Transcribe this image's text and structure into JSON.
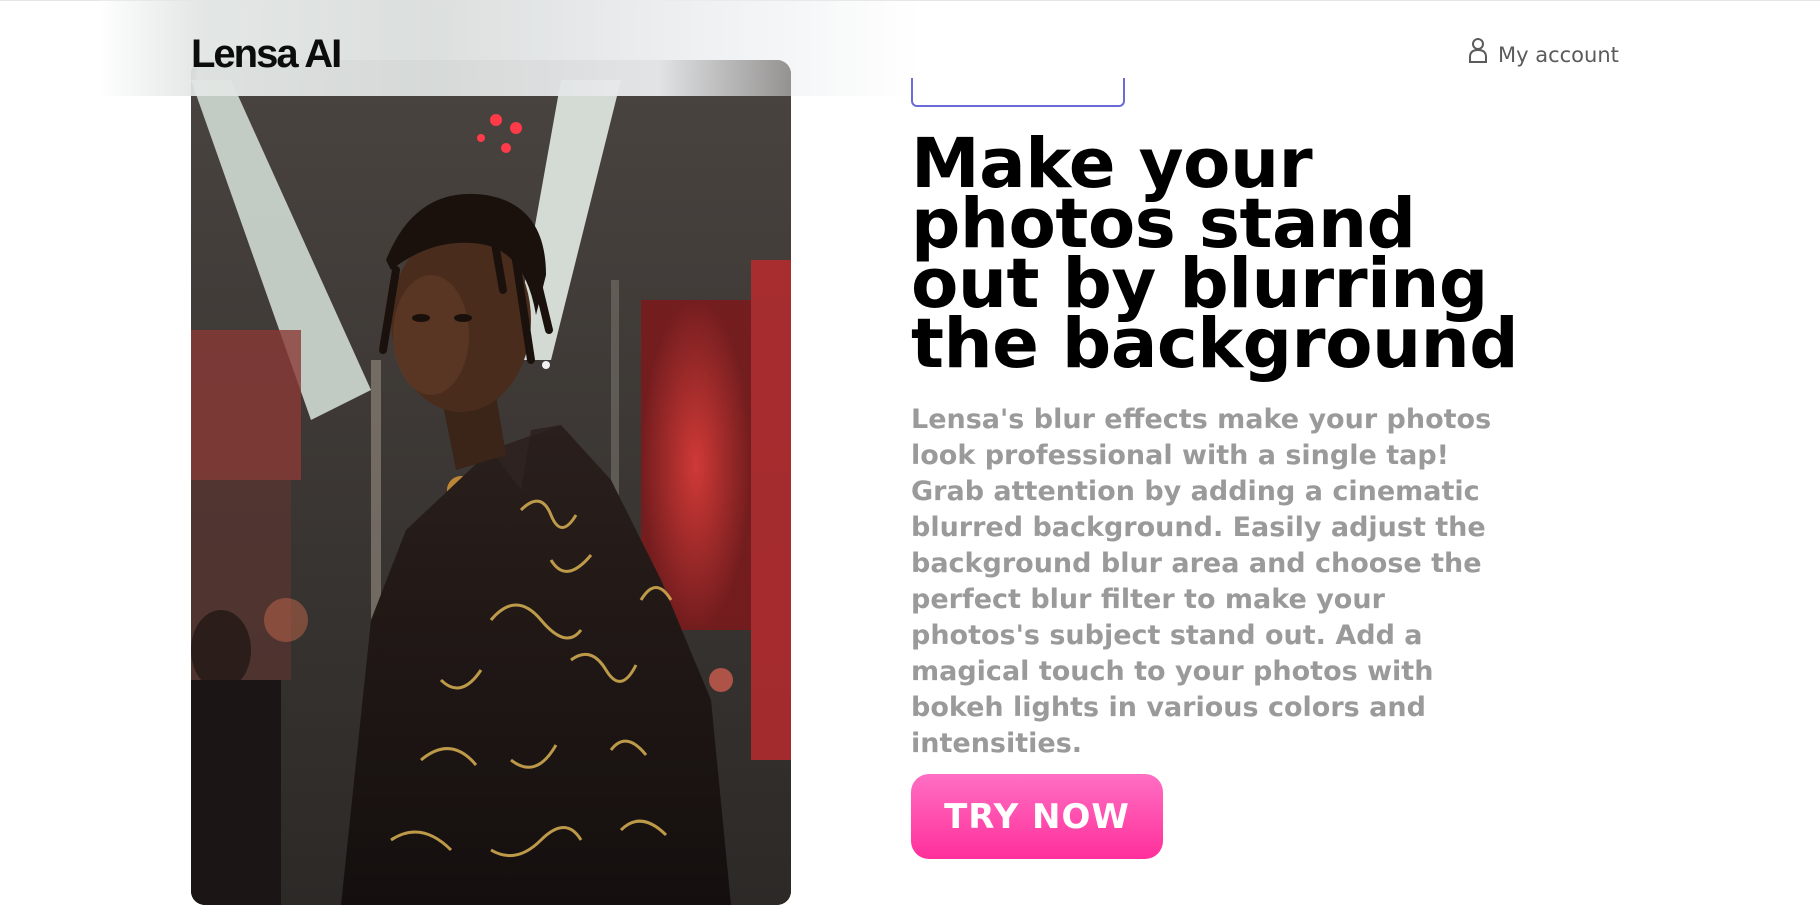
{
  "header": {
    "logo": "Lensa AI",
    "account_label": "My account"
  },
  "hero": {
    "badge_text": "",
    "headline": "Make your photos stand out by blurring the background",
    "description": "Lensa's blur effects make your photos look professional with a single tap! Grab attention by adding a cinematic blurred background. Easily adjust the background blur area and choose the perfect blur filter to make your photos's subject stand out. Add a magical touch to your photos with bokeh lights in various colors and intensities.",
    "cta_label": "TRY NOW"
  },
  "icons": {
    "account": "user-icon"
  },
  "colors": {
    "cta_top": "#ff6fc3",
    "cta_bottom": "#ff2f9b",
    "badge_border": "#6a6ad9",
    "description": "#9a9a9a"
  }
}
